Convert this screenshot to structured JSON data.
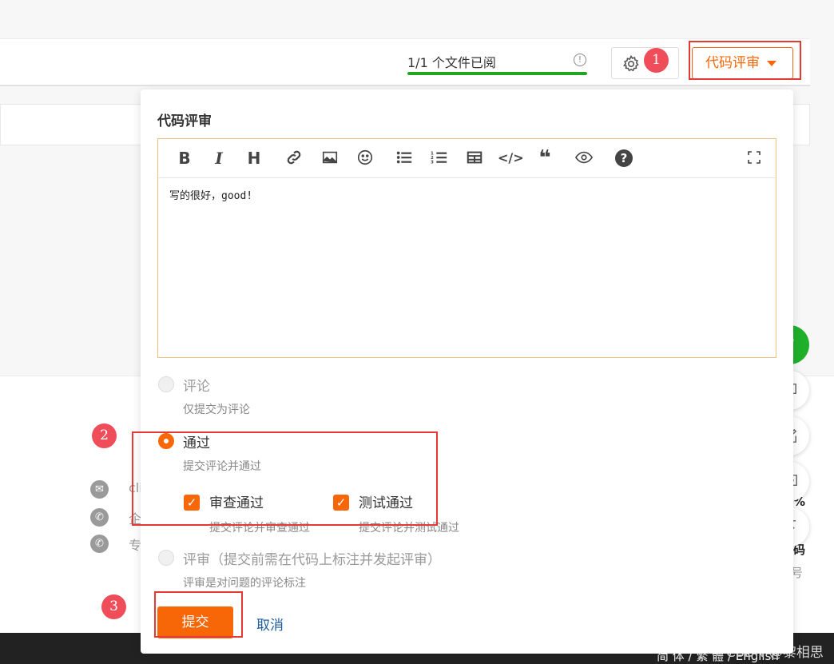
{
  "header": {
    "progress_text": "1/1 个文件已阅",
    "progress_fraction": 1.0,
    "info_icon_glyph": "!",
    "review_button_label": "代码评审",
    "progress_color": "#1fa51f",
    "accent_color": "#f76707"
  },
  "popover": {
    "title": "代码评审",
    "toolbar": [
      {
        "name": "bold-icon",
        "glyph": "B"
      },
      {
        "name": "italic-icon",
        "glyph": "I"
      },
      {
        "name": "heading-icon",
        "glyph": "H"
      },
      {
        "name": "link-icon",
        "glyph": ""
      },
      {
        "name": "image-icon",
        "glyph": ""
      },
      {
        "name": "emoji-icon",
        "glyph": ""
      },
      {
        "name": "bullet-list-icon",
        "glyph": ""
      },
      {
        "name": "numbered-list-icon",
        "glyph": ""
      },
      {
        "name": "table-icon",
        "glyph": ""
      },
      {
        "name": "code-icon",
        "glyph": "</>"
      },
      {
        "name": "quote-icon",
        "glyph": "❝"
      },
      {
        "name": "preview-icon",
        "glyph": ""
      },
      {
        "name": "help-icon",
        "glyph": "?"
      },
      {
        "name": "fullscreen-icon",
        "glyph": ""
      }
    ],
    "comment_text": "写的很好，good!",
    "options": {
      "comment": {
        "label": "评论",
        "desc": "仅提交为评论",
        "selected": false
      },
      "approve": {
        "label": "通过",
        "desc": "提交评论并通过",
        "selected": true
      },
      "review": {
        "label": "评审（提交前需在代码上标注并发起评审）",
        "desc": "评审是对问题的评论标注",
        "selected": false
      }
    },
    "checks": {
      "review_pass": {
        "label": "审查通过",
        "desc": "提交评论并审查通过",
        "checked": true
      },
      "test_pass": {
        "label": "测试通过",
        "desc": "提交评论并测试通过",
        "checked": true
      }
    },
    "submit_label": "提交",
    "cancel_label": "取消"
  },
  "float_buttons": {
    "help_glyph": "?"
  },
  "background": {
    "contact_fragments": [
      "cli",
      "企",
      "专"
    ],
    "qr_fragments": [
      "码",
      "%"
    ],
    "side_char": "号",
    "language_switch": "简 体 / 繁 體 / English",
    "watermark": "CSDN @黎相思"
  },
  "annotations": [
    "1",
    "2",
    "3"
  ]
}
